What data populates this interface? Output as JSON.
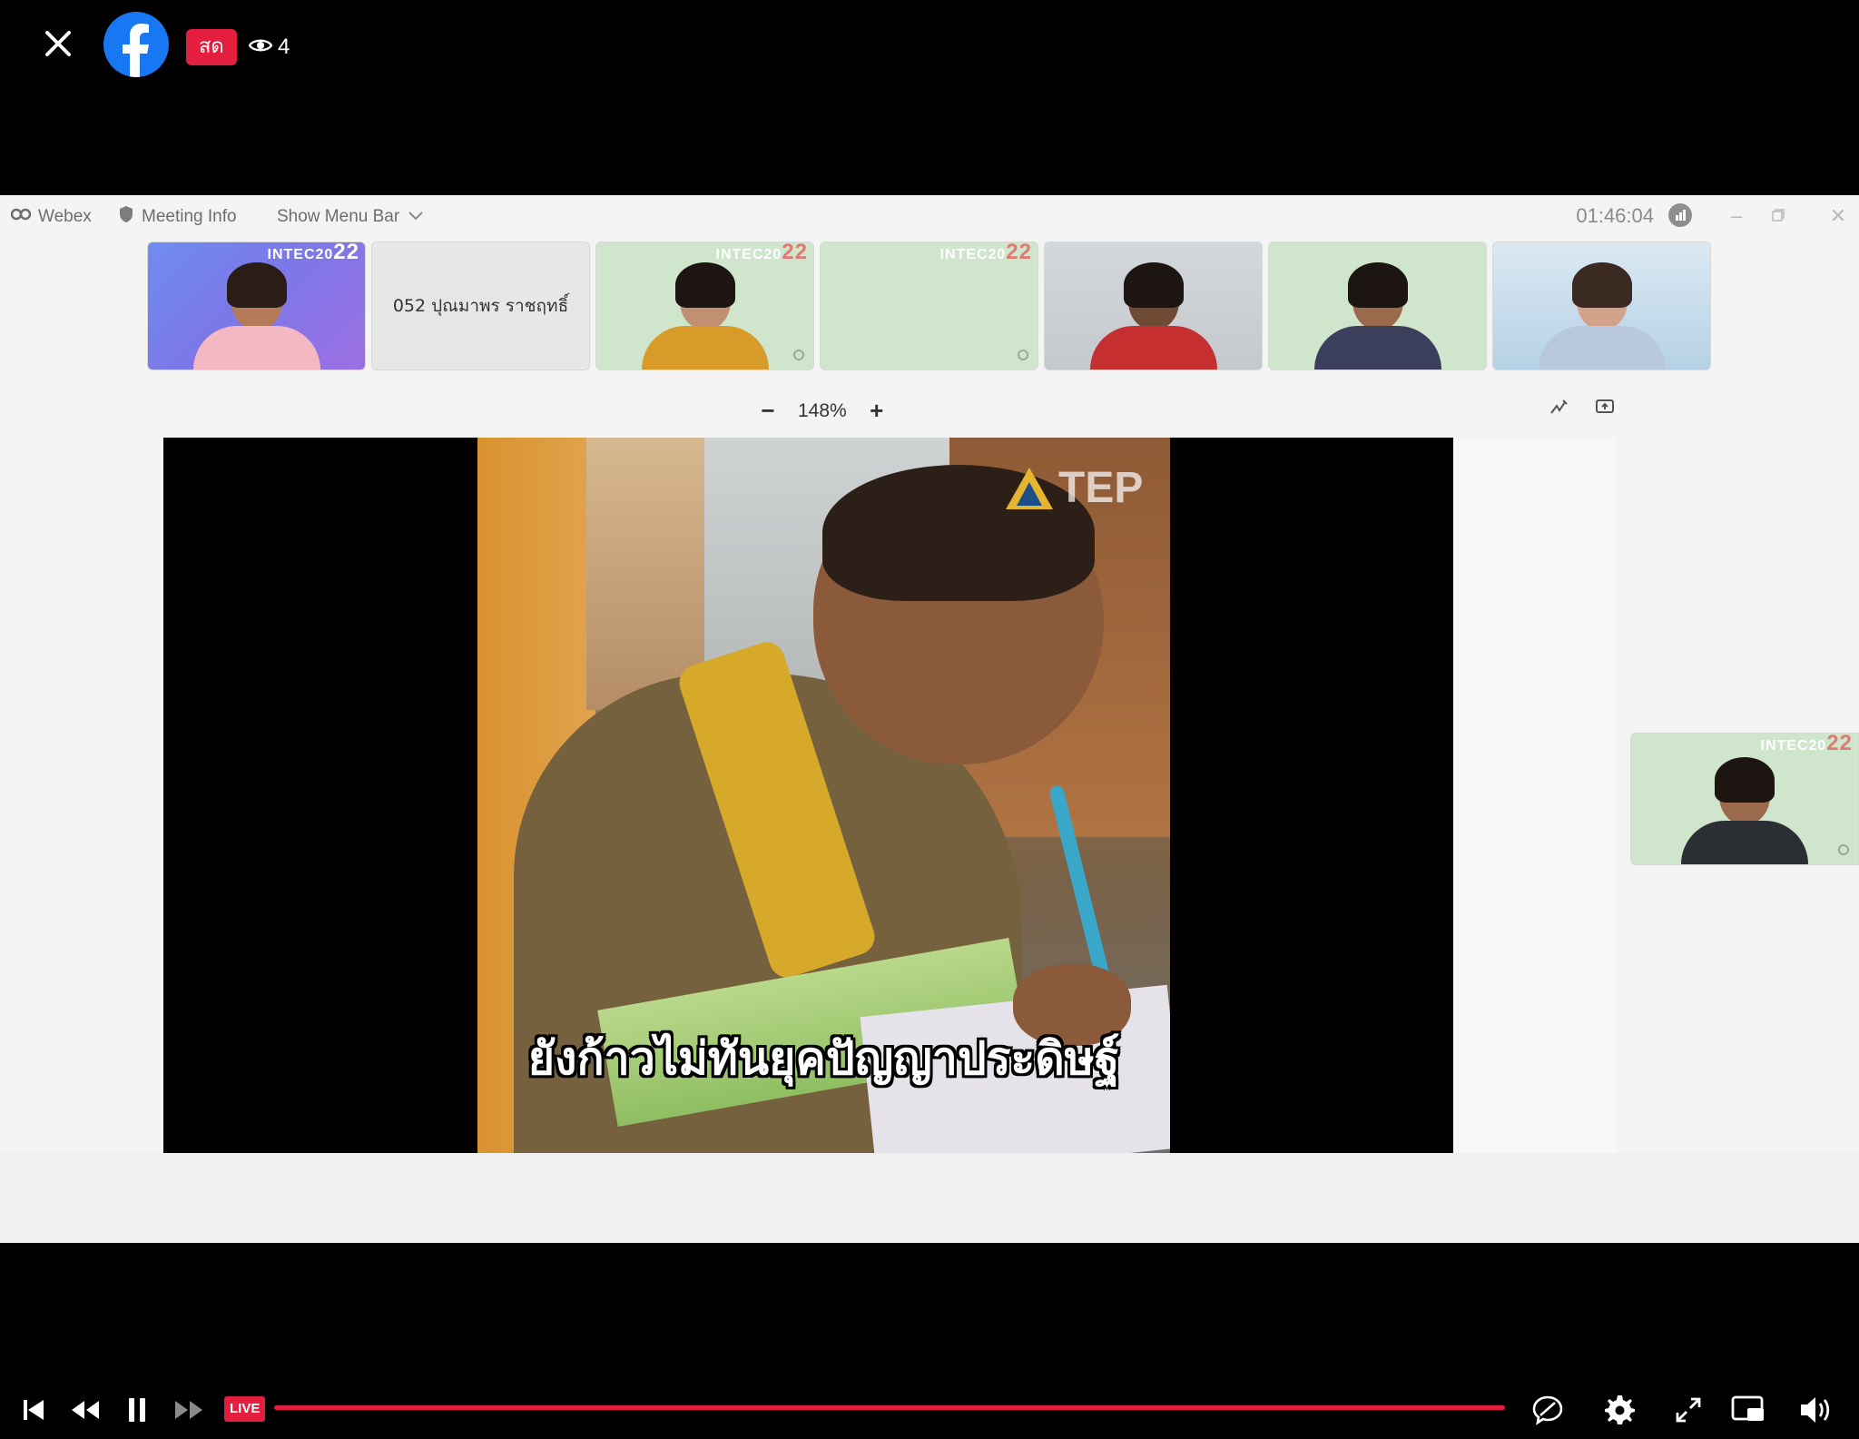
{
  "facebook": {
    "live_label": "สด",
    "viewer_count": "4",
    "live_chip": "LIVE"
  },
  "webex": {
    "menu": {
      "app_name": "Webex",
      "meeting_info": "Meeting Info",
      "show_menu_bar": "Show Menu Bar"
    },
    "timer": "01:46:04",
    "participants": [
      {
        "brand": "INTEC20",
        "brand_num": "22"
      },
      {
        "name": "052 ปุณมาพร ราชฤทธิ์"
      },
      {
        "brand": "INTEC20",
        "brand_num": "22"
      },
      {
        "brand": "INTEC20",
        "brand_num": "22"
      }
    ],
    "self_view": {
      "brand": "INTEC20",
      "brand_num": "22"
    },
    "zoom_level": "148%",
    "shared_video": {
      "watermark": "TEP",
      "caption": "ยังก้าวไม่ทันยุคปัญญาประดิษฐ์"
    }
  },
  "colors": {
    "accent_red": "#e41e3f",
    "facebook_blue": "#1877f2"
  }
}
